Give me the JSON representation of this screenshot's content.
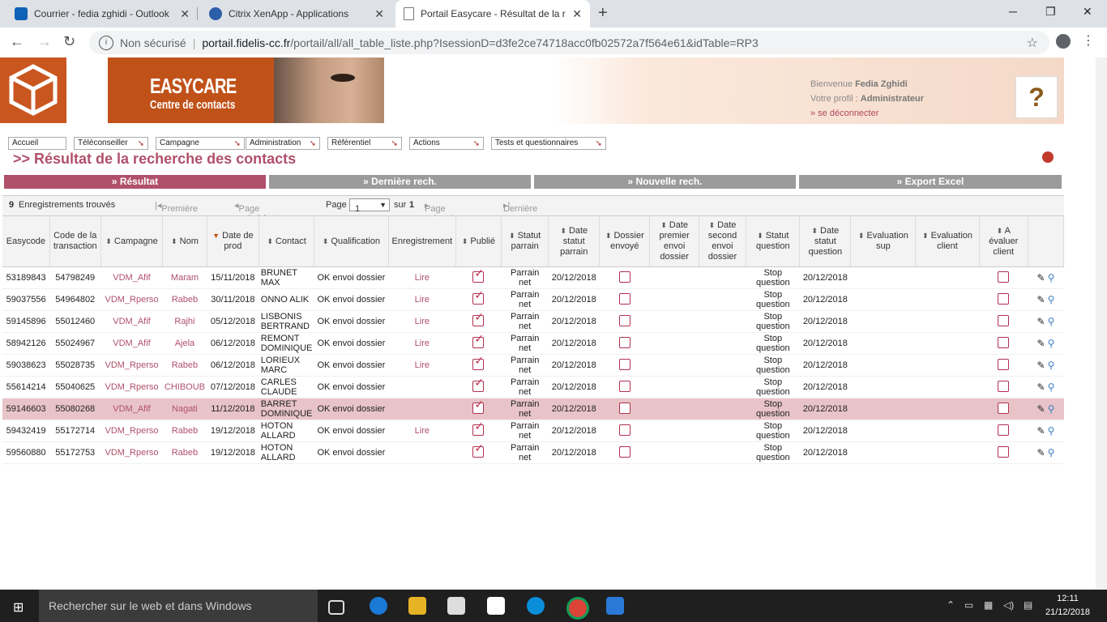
{
  "browser": {
    "tabs": [
      {
        "label": "Courrier - fedia zghidi - Outlook",
        "icon": "outlook-icon",
        "color": "#0f62b5"
      },
      {
        "label": "Citrix XenApp - Applications",
        "icon": "citrix-icon",
        "color": "#2b5fa8"
      },
      {
        "label": "Portail Easycare - Résultat de la r",
        "icon": "page-icon",
        "color": "#777777"
      }
    ],
    "security": "Non sécurisé",
    "url_host": "portail.fidelis-cc.fr",
    "url_path": "/portail/all/all_table_liste.php?IsessionD=d3fe2ce74718acc0fb02572a7f564e61&idTable=RP3"
  },
  "header": {
    "brand_line1": "EASYCARE",
    "brand_line2": "Centre de contacts",
    "welcome_prefix": "Bienvenue",
    "user_name": "Fedia Zghidi",
    "profile_label": "Votre profil :",
    "profile_value": "Administrateur",
    "logout": "» se déconnecter",
    "help": "?"
  },
  "menu": [
    {
      "label": "Accueil"
    },
    {
      "label": "Téléconseiller"
    },
    {
      "label": "Campagne"
    },
    {
      "label": "Administration"
    },
    {
      "label": "Référentiel"
    },
    {
      "label": "Actions"
    },
    {
      "label": "Tests et questionnaires"
    }
  ],
  "page_title": ">> Résultat de la recherche des contacts",
  "tabs": [
    {
      "label": "» Résultat"
    },
    {
      "label": "» Dernière rech."
    },
    {
      "label": "» Nouvelle rech."
    },
    {
      "label": "» Export Excel"
    }
  ],
  "pager": {
    "count": "9",
    "count_label": "Enregistrements trouvés",
    "first": "Première page",
    "prev": "Page précédente",
    "page_label": "Page",
    "page_value": "1",
    "of_label": "sur",
    "total_pages": "1",
    "next": "Page suivante",
    "last": "Dernière page"
  },
  "columns": [
    "Easycode",
    "Code de la transaction",
    "Campagne",
    "Nom",
    "Date de prod",
    "Contact",
    "Qualification",
    "Enregistrement",
    "Publié",
    "Statut parrain",
    "Date statut parrain",
    "Dossier envoyé",
    "Date premier envoi dossier",
    "Date second envoi dossier",
    "Statut question",
    "Date statut question",
    "Evaluation sup",
    "Evaluation client",
    "A évaluer client"
  ],
  "rows": [
    {
      "easycode": "53189843",
      "code": "54798249",
      "campagne": "VDM_Afif",
      "nom": "Maram",
      "date": "15/11/2018",
      "contact1": "BRUNET",
      "contact2": "MAX",
      "qualif": "OK envoi dossier",
      "enreg": "Lire",
      "statut1": "Parrain",
      "statut2": "net",
      "date_parrain": "20/12/2018",
      "squest1": "Stop",
      "squest2": "question",
      "date_quest": "20/12/2018"
    },
    {
      "easycode": "59037556",
      "code": "54964802",
      "campagne": "VDM_Rperso",
      "nom": "Rabeb",
      "date": "30/11/2018",
      "contact1": "ONNO ALIK",
      "contact2": "",
      "qualif": "OK envoi dossier",
      "enreg": "Lire",
      "statut1": "Parrain",
      "statut2": "net",
      "date_parrain": "20/12/2018",
      "squest1": "Stop",
      "squest2": "question",
      "date_quest": "20/12/2018"
    },
    {
      "easycode": "59145896",
      "code": "55012460",
      "campagne": "VDM_Afif",
      "nom": "Rajhi",
      "date": "05/12/2018",
      "contact1": "LISBONIS",
      "contact2": "BERTRAND",
      "qualif": "OK envoi dossier",
      "enreg": "Lire",
      "statut1": "Parrain",
      "statut2": "net",
      "date_parrain": "20/12/2018",
      "squest1": "Stop",
      "squest2": "question",
      "date_quest": "20/12/2018"
    },
    {
      "easycode": "58942126",
      "code": "55024967",
      "campagne": "VDM_Afif",
      "nom": "Ajela",
      "date": "06/12/2018",
      "contact1": "REMONT",
      "contact2": "DOMINIQUE",
      "qualif": "OK envoi dossier",
      "enreg": "Lire",
      "statut1": "Parrain",
      "statut2": "net",
      "date_parrain": "20/12/2018",
      "squest1": "Stop",
      "squest2": "question",
      "date_quest": "20/12/2018"
    },
    {
      "easycode": "59038623",
      "code": "55028735",
      "campagne": "VDM_Rperso",
      "nom": "Rabeb",
      "date": "06/12/2018",
      "contact1": "LORIEUX",
      "contact2": "MARC",
      "qualif": "OK envoi dossier",
      "enreg": "Lire",
      "statut1": "Parrain",
      "statut2": "net",
      "date_parrain": "20/12/2018",
      "squest1": "Stop",
      "squest2": "question",
      "date_quest": "20/12/2018"
    },
    {
      "easycode": "55614214",
      "code": "55040625",
      "campagne": "VDM_Rperso",
      "nom": "CHIBOUB",
      "date": "07/12/2018",
      "contact1": "CARLES",
      "contact2": "CLAUDE",
      "qualif": "OK envoi dossier",
      "enreg": "",
      "statut1": "Parrain",
      "statut2": "net",
      "date_parrain": "20/12/2018",
      "squest1": "Stop",
      "squest2": "question",
      "date_quest": "20/12/2018"
    },
    {
      "easycode": "59146603",
      "code": "55080268",
      "campagne": "VDM_Afif",
      "nom": "Nagati",
      "date": "11/12/2018",
      "contact1": "BARRET",
      "contact2": "DOMINIQUE",
      "qualif": "OK envoi dossier",
      "enreg": "",
      "statut1": "Parrain",
      "statut2": "net",
      "date_parrain": "20/12/2018",
      "squest1": "Stop",
      "squest2": "question",
      "date_quest": "20/12/2018"
    },
    {
      "easycode": "59432419",
      "code": "55172714",
      "campagne": "VDM_Rperso",
      "nom": "Rabeb",
      "date": "19/12/2018",
      "contact1": "HOTON",
      "contact2": "ALLARD",
      "qualif": "OK envoi dossier",
      "enreg": "Lire",
      "statut1": "Parrain",
      "statut2": "net",
      "date_parrain": "20/12/2018",
      "squest1": "Stop",
      "squest2": "question",
      "date_quest": "20/12/2018"
    },
    {
      "easycode": "59560880",
      "code": "55172753",
      "campagne": "VDM_Rperso",
      "nom": "Rabeb",
      "date": "19/12/2018",
      "contact1": "HOTON",
      "contact2": "ALLARD",
      "qualif": "OK envoi dossier",
      "enreg": "",
      "statut1": "Parrain",
      "statut2": "net",
      "date_parrain": "20/12/2018",
      "squest1": "Stop",
      "squest2": "question",
      "date_quest": "20/12/2018"
    }
  ],
  "taskbar": {
    "search": "Rechercher sur le web et dans Windows",
    "time": "12:11",
    "date": "21/12/2018"
  }
}
